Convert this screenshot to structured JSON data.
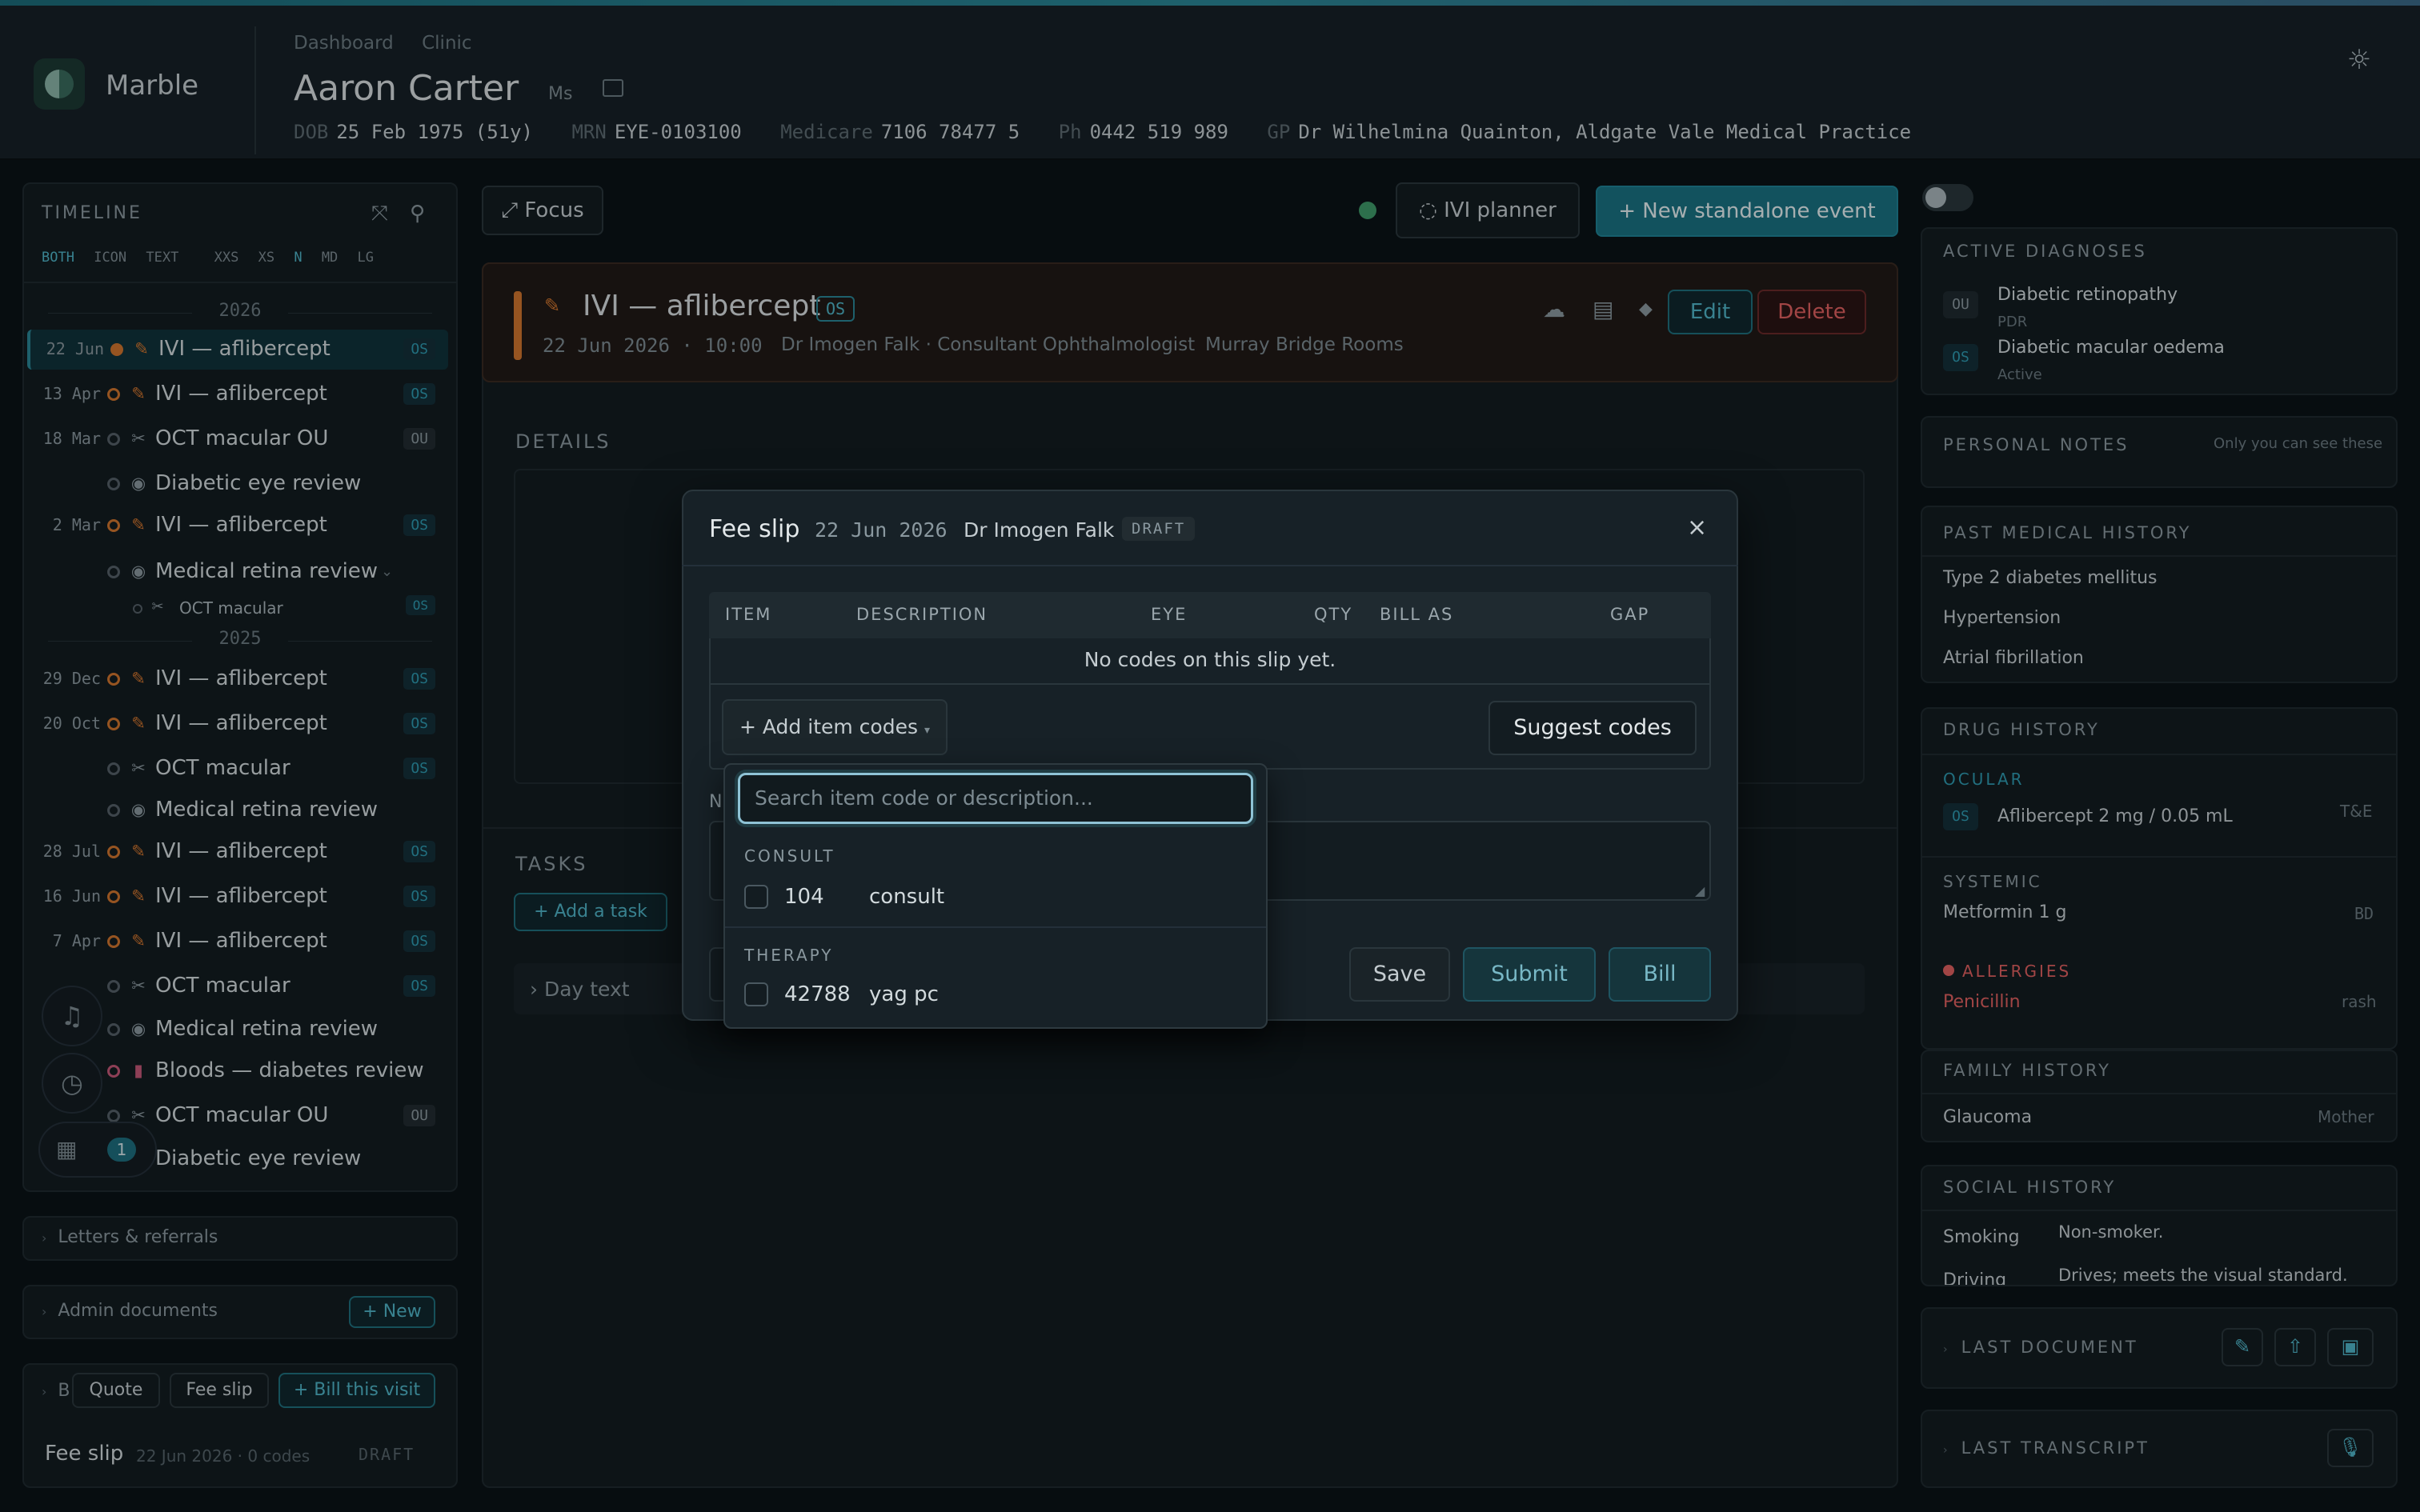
{
  "header": {
    "brand": "Marble",
    "breadcrumbs": [
      "Dashboard",
      "Clinic"
    ],
    "patient_name": "Aaron Carter",
    "patient_title": "Ms",
    "demographics": [
      {
        "k": "DOB",
        "v": "25 Feb 1975 (51y)"
      },
      {
        "k": "MRN",
        "v": "EYE-0103100"
      },
      {
        "k": "Medicare",
        "v": "7106 78477 5"
      },
      {
        "k": "Ph",
        "v": "0442 519 989"
      },
      {
        "k": "GP",
        "v": "Dr Wilhelmina Quainton, Aldgate Vale Medical Practice"
      }
    ]
  },
  "timeline": {
    "title": "TIMELINE",
    "modes": [
      "BOTH",
      "ICON",
      "TEXT"
    ],
    "sizes": [
      "XXS",
      "XS",
      "N",
      "MD",
      "LG"
    ],
    "active_mode": "BOTH",
    "active_size": "N",
    "years": [
      "2026",
      "2025"
    ],
    "items": [
      {
        "date": "22 Jun",
        "label": "IVI — aflibercept",
        "eye": "OS"
      },
      {
        "date": "13 Apr",
        "label": "IVI — aflibercept",
        "eye": "OS"
      },
      {
        "date": "18 Mar",
        "label": "OCT macular OU",
        "eye": "OU"
      },
      {
        "date": "",
        "label": "Diabetic eye review",
        "eye": ""
      },
      {
        "date": "2 Mar",
        "label": "IVI — aflibercept",
        "eye": "OS"
      },
      {
        "date": "",
        "label": "Medical retina review",
        "eye": ""
      },
      {
        "date": "",
        "label": "OCT macular",
        "eye": "OS"
      },
      {
        "date": "29 Dec",
        "label": "IVI — aflibercept",
        "eye": "OS"
      },
      {
        "date": "20 Oct",
        "label": "IVI — aflibercept",
        "eye": "OS"
      },
      {
        "date": "",
        "label": "OCT macular",
        "eye": "OS"
      },
      {
        "date": "",
        "label": "Medical retina review",
        "eye": ""
      },
      {
        "date": "28 Jul",
        "label": "IVI — aflibercept",
        "eye": "OS"
      },
      {
        "date": "16 Jun",
        "label": "IVI — aflibercept",
        "eye": "OS"
      },
      {
        "date": "7 Apr",
        "label": "IVI — aflibercept",
        "eye": "OS"
      },
      {
        "date": "",
        "label": "OCT macular",
        "eye": "OS"
      },
      {
        "date": "",
        "label": "Medical retina review",
        "eye": ""
      },
      {
        "date": "",
        "label": "Bloods — diabetes review",
        "eye": ""
      },
      {
        "date": "",
        "label": "OCT macular OU",
        "eye": "OU"
      },
      {
        "date": "",
        "label": "Diabetic eye review",
        "eye": ""
      }
    ],
    "notification_count": "1"
  },
  "left_sections": {
    "letters": "Letters & referrals",
    "admin": "Admin documents",
    "admin_new": "+ New",
    "billing_prefix": "B",
    "quote": "Quote",
    "fee_slip": "Fee slip",
    "bill_visit": "+ Bill this visit",
    "slip_title": "Fee slip",
    "slip_meta": "22 Jun 2026 · 0 codes",
    "slip_status": "DRAFT"
  },
  "toolbar": {
    "focus": "⤢ Focus",
    "ivi_planner": "◌ IVI planner",
    "new_event": "+ New standalone event"
  },
  "event": {
    "title": "IVI — aflibercept",
    "eye": "OS",
    "meta": "22 Jun 2026 · 10:00",
    "doctor": "Dr Imogen Falk · Consultant Ophthalmologist",
    "location": "Murray Bridge Rooms",
    "edit": "Edit",
    "delete": "Delete",
    "details": "DETAILS",
    "tasks": "TASKS",
    "add_task": "+ Add a task",
    "day_text": "› Day text"
  },
  "right": {
    "active_dx_title": "ACTIVE DIAGNOSES",
    "dx": [
      {
        "eye": "OU",
        "name": "Diabetic retinopathy",
        "sub": "PDR"
      },
      {
        "eye": "OS",
        "name": "Diabetic macular oedema",
        "sub": "Active"
      }
    ],
    "notes_title": "PERSONAL NOTES",
    "notes_hint": "Only you can see these",
    "pmh_title": "PAST MEDICAL HISTORY",
    "pmh": [
      "Type 2 diabetes mellitus",
      "Hypertension",
      "Atrial fibrillation"
    ],
    "drug_title": "DRUG HISTORY",
    "ocular": "OCULAR",
    "ocular_drug": {
      "eye": "OS",
      "name": "Aflibercept 2 mg / 0.05 mL",
      "regimen": "T&E"
    },
    "systemic": "SYSTEMIC",
    "systemic_drug": {
      "name": "Metformin 1 g",
      "freq": "BD"
    },
    "allergies": "ALLERGIES",
    "allergy": {
      "name": "Penicillin",
      "reaction": "rash"
    },
    "fh_title": "FAMILY HISTORY",
    "fh": {
      "name": "Glaucoma",
      "who": "Mother"
    },
    "sh_title": "SOCIAL HISTORY",
    "sh": [
      {
        "k": "Smoking",
        "v": "Non-smoker."
      },
      {
        "k": "Driving",
        "v": "Drives; meets the visual standard."
      }
    ],
    "last_doc": "LAST DOCUMENT",
    "last_transcript": "LAST TRANSCRIPT"
  },
  "modal": {
    "title": "Fee slip",
    "date": "22 Jun 2026",
    "doctor": "Dr Imogen Falk",
    "status": "DRAFT",
    "columns": [
      "ITEM",
      "DESCRIPTION",
      "EYE",
      "QTY",
      "BILL AS",
      "GAP"
    ],
    "empty": "No codes on this slip yet.",
    "add_codes": "+ Add item codes",
    "suggest": "Suggest codes",
    "save": "Save",
    "submit": "Submit",
    "bill": "Bill",
    "search_placeholder": "Search item code or description...",
    "groups": [
      {
        "name": "CONSULT",
        "items": [
          {
            "code": "104",
            "desc": "consult"
          }
        ]
      },
      {
        "name": "THERAPY",
        "items": [
          {
            "code": "42788",
            "desc": "yag pc"
          }
        ]
      }
    ]
  },
  "colors": {
    "accent": "#1a7283",
    "orange": "#d0752f",
    "danger": "#e06060",
    "green": "#3f9a6a"
  }
}
